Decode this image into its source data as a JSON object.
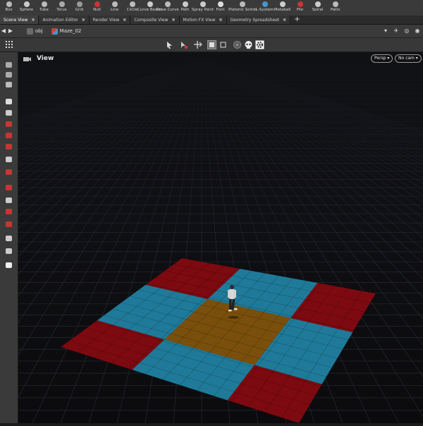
{
  "shelf": {
    "tools": [
      {
        "label": "Box",
        "icon": "box-icon"
      },
      {
        "label": "Sphere",
        "icon": "sphere-icon"
      },
      {
        "label": "Tube",
        "icon": "tube-icon"
      },
      {
        "label": "Torus",
        "icon": "torus-icon"
      },
      {
        "label": "Grid",
        "icon": "grid-icon"
      },
      {
        "label": "Null",
        "icon": "null-icon"
      },
      {
        "label": "Line",
        "icon": "line-icon"
      },
      {
        "label": "Circle",
        "icon": "circle-icon"
      },
      {
        "label": "Curve Bezier",
        "icon": "curve-bezier-icon"
      },
      {
        "label": "Draw Curve",
        "icon": "draw-curve-icon"
      },
      {
        "label": "Path",
        "icon": "path-icon"
      },
      {
        "label": "Spray Paint",
        "icon": "spray-paint-icon"
      },
      {
        "label": "Font",
        "icon": "font-icon"
      },
      {
        "label": "Platonic Solids",
        "icon": "platonic-solids-icon"
      },
      {
        "label": "L-System",
        "icon": "l-system-icon"
      },
      {
        "label": "Metaball",
        "icon": "metaball-icon"
      },
      {
        "label": "File",
        "icon": "file-icon"
      },
      {
        "label": "Spiral",
        "icon": "spiral-icon"
      },
      {
        "label": "Helix",
        "icon": "helix-icon"
      }
    ]
  },
  "tabs": [
    {
      "label": "Scene View",
      "active": true
    },
    {
      "label": "Animation Editor",
      "active": false
    },
    {
      "label": "Render View",
      "active": false
    },
    {
      "label": "Composite View",
      "active": false
    },
    {
      "label": "Motion FX View",
      "active": false
    },
    {
      "label": "Geometry Spreadsheet",
      "active": false
    }
  ],
  "tab_close_glyph": "✖",
  "tab_add_glyph": "+",
  "path": {
    "root": "obj",
    "node": "Maze_02"
  },
  "viewport": {
    "title": "View",
    "camera_mode": "Persp ▾",
    "camera": "No cam ▾"
  },
  "floor_colors": {
    "center": "#7a4f0c",
    "edge": "#1f7a99",
    "corner": "#7d0a10",
    "grid": "#2a2f3a",
    "background": "#0f0f12"
  }
}
